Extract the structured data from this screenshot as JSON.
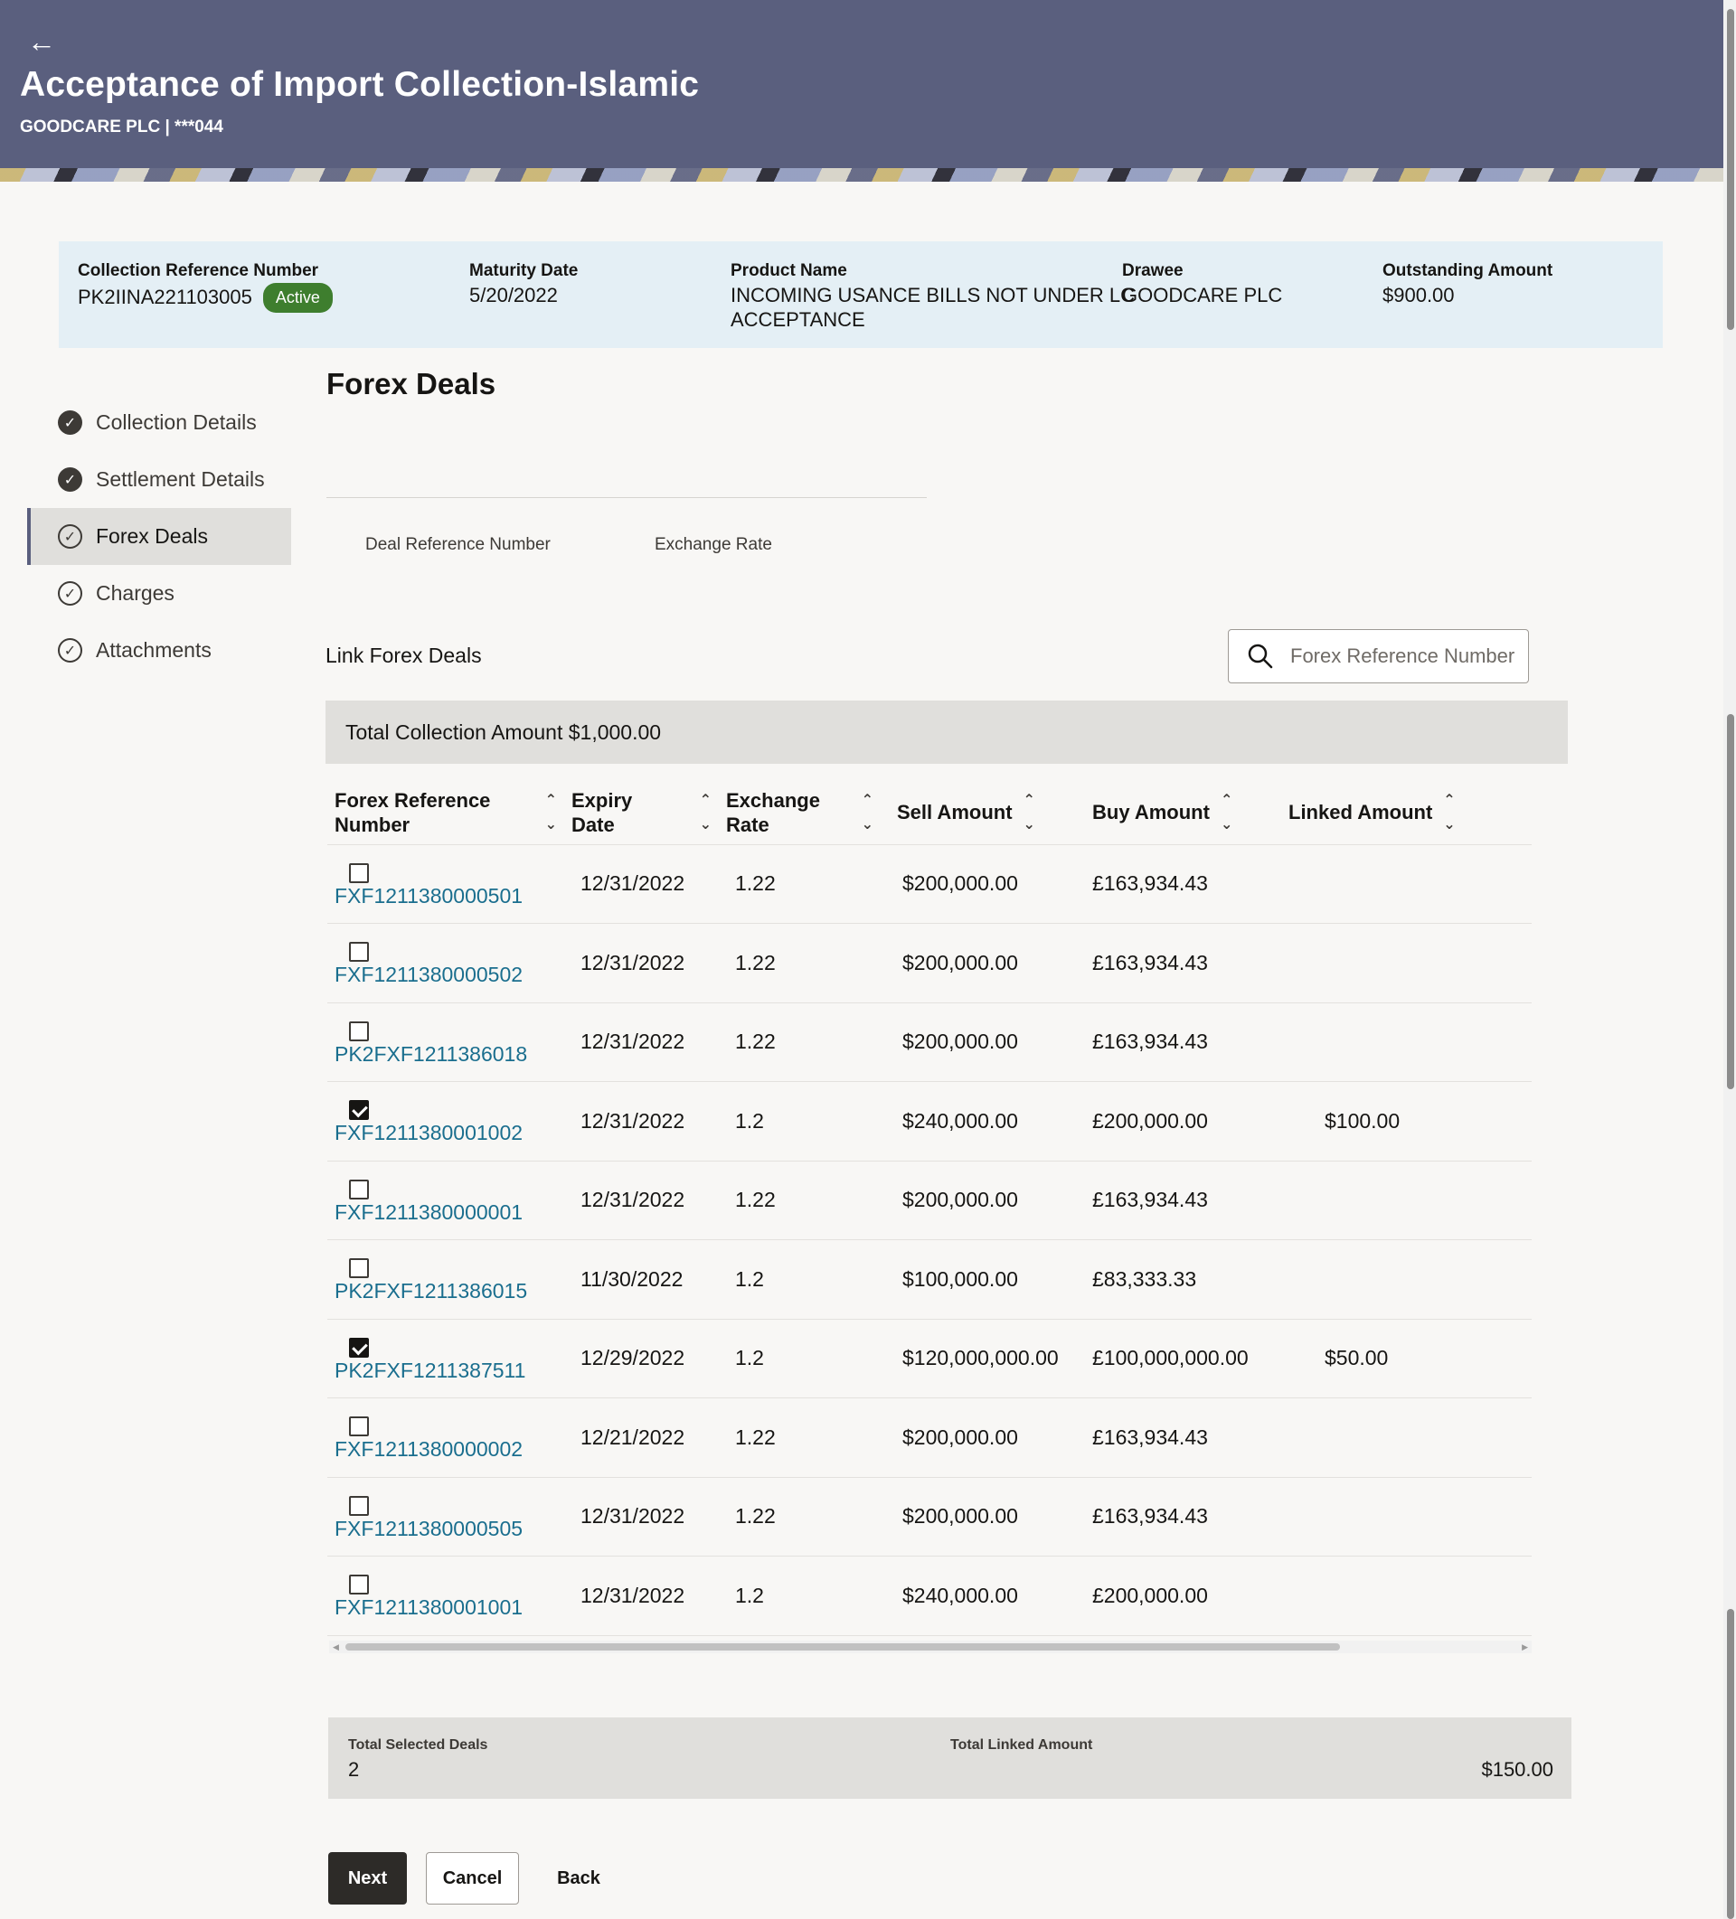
{
  "header": {
    "title": "Acceptance of Import Collection-Islamic",
    "subtitle": "GOODCARE PLC | ***044"
  },
  "summary": {
    "collection_ref_label": "Collection Reference Number",
    "collection_ref_value": "PK2IINA221103005",
    "status": "Active",
    "maturity_label": "Maturity Date",
    "maturity_value": "5/20/2022",
    "product_label": "Product Name",
    "product_value_line1": "INCOMING USANCE BILLS NOT UNDER LC",
    "product_value_line2": "ACCEPTANCE",
    "drawee_label": "Drawee",
    "drawee_value": "GOODCARE PLC",
    "outstanding_label": "Outstanding Amount",
    "outstanding_value": "$900.00"
  },
  "nav": {
    "items": [
      {
        "label": "Collection Details",
        "state": "done"
      },
      {
        "label": "Settlement Details",
        "state": "done"
      },
      {
        "label": "Forex Deals",
        "state": "active"
      },
      {
        "label": "Charges",
        "state": "pending"
      },
      {
        "label": "Attachments",
        "state": "pending"
      }
    ]
  },
  "section": {
    "title": "Forex Deals",
    "deal_ref_label": "Deal Reference Number",
    "exchange_rate_label": "Exchange Rate",
    "link_label": "Link Forex Deals",
    "search_placeholder": "Forex Reference Number",
    "total_collection": "Total Collection Amount $1,000.00"
  },
  "table": {
    "headers": {
      "ref_line1": "Forex Reference",
      "ref_line2": "Number",
      "expiry_line1": "Expiry",
      "expiry_line2": "Date",
      "rate_line1": "Exchange",
      "rate_line2": "Rate",
      "sell": "Sell Amount",
      "buy": "Buy Amount",
      "linked": "Linked Amount"
    },
    "rows": [
      {
        "ref": "FXF1211380000501",
        "expiry": "12/31/2022",
        "rate": "1.22",
        "sell": "$200,000.00",
        "buy": "£163,934.43",
        "linked": "",
        "checked": false
      },
      {
        "ref": "FXF1211380000502",
        "expiry": "12/31/2022",
        "rate": "1.22",
        "sell": "$200,000.00",
        "buy": "£163,934.43",
        "linked": "",
        "checked": false
      },
      {
        "ref": "PK2FXF1211386018",
        "expiry": "12/31/2022",
        "rate": "1.22",
        "sell": "$200,000.00",
        "buy": "£163,934.43",
        "linked": "",
        "checked": false
      },
      {
        "ref": "FXF1211380001002",
        "expiry": "12/31/2022",
        "rate": "1.2",
        "sell": "$240,000.00",
        "buy": "£200,000.00",
        "linked": "$100.00",
        "checked": true
      },
      {
        "ref": "FXF1211380000001",
        "expiry": "12/31/2022",
        "rate": "1.22",
        "sell": "$200,000.00",
        "buy": "£163,934.43",
        "linked": "",
        "checked": false
      },
      {
        "ref": "PK2FXF1211386015",
        "expiry": "11/30/2022",
        "rate": "1.2",
        "sell": "$100,000.00",
        "buy": "£83,333.33",
        "linked": "",
        "checked": false
      },
      {
        "ref": "PK2FXF1211387511",
        "expiry": "12/29/2022",
        "rate": "1.2",
        "sell": "$120,000,000.00",
        "buy": "£100,000,000.00",
        "linked": "$50.00",
        "checked": true
      },
      {
        "ref": "FXF1211380000002",
        "expiry": "12/21/2022",
        "rate": "1.22",
        "sell": "$200,000.00",
        "buy": "£163,934.43",
        "linked": "",
        "checked": false
      },
      {
        "ref": "FXF1211380000505",
        "expiry": "12/31/2022",
        "rate": "1.22",
        "sell": "$200,000.00",
        "buy": "£163,934.43",
        "linked": "",
        "checked": false
      },
      {
        "ref": "FXF1211380001001",
        "expiry": "12/31/2022",
        "rate": "1.2",
        "sell": "$240,000.00",
        "buy": "£200,000.00",
        "linked": "",
        "checked": false
      }
    ]
  },
  "footer": {
    "selected_label": "Total Selected Deals",
    "selected_value": "2",
    "linked_label": "Total Linked Amount",
    "linked_value": "$150.00"
  },
  "buttons": {
    "next": "Next",
    "cancel": "Cancel",
    "back": "Back"
  },
  "colors": {
    "header_bg": "#5a5f7e",
    "summary_bg": "#e4eff5",
    "status_badge": "#3e7e2e",
    "link": "#1a6e8e",
    "primary_button": "#2d2b28"
  }
}
